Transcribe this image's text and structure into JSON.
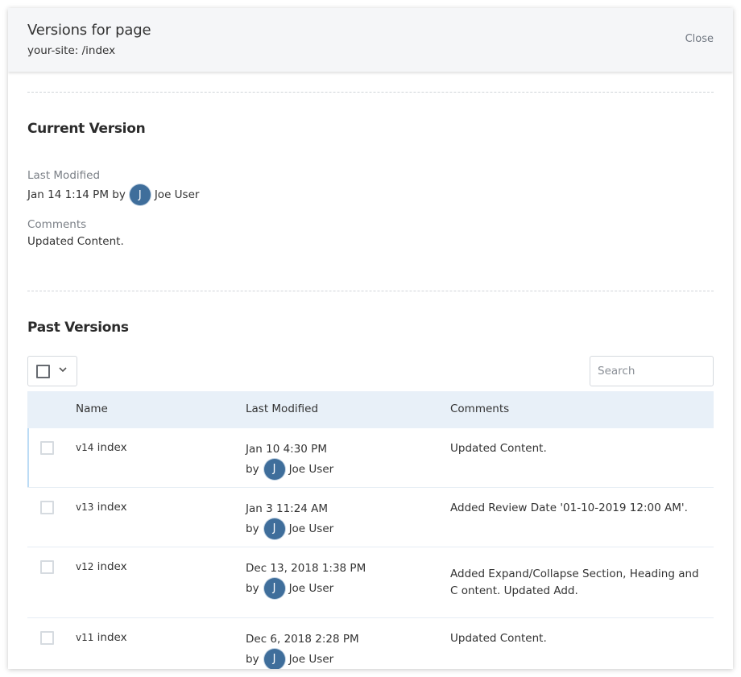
{
  "header": {
    "title": "Versions for page",
    "subtitle": "your-site: /index",
    "close_label": "Close"
  },
  "current_version": {
    "section_title": "Current Version",
    "last_modified_label": "Last Modified",
    "last_modified_value": "Jan 14 1:14 PM by",
    "user_initial": "J",
    "user_name": "Joe User",
    "comments_label": "Comments",
    "comments_value": "Updated Content."
  },
  "past_versions": {
    "section_title": "Past Versions",
    "bulk_select_icon": "checkbox-icon",
    "bulk_chevron_icon": "chevron-down-icon",
    "search_placeholder": "Search",
    "search_value": "",
    "columns": [
      "Name",
      "Last Modified",
      "Comments"
    ],
    "rows": [
      {
        "version": "v14",
        "name": "index",
        "date": "Jan 10 4:30 PM",
        "by_label": "by",
        "user_initial": "J",
        "user_name": "Joe User",
        "comment": "Updated Content.",
        "selected_marker": true
      },
      {
        "version": "v13",
        "name": "index",
        "date": "Jan 3 11:24 AM",
        "by_label": "by",
        "user_initial": "J",
        "user_name": "Joe User",
        "comment": "Added Review Date '01-10-2019 12:00 AM'.",
        "selected_marker": false
      },
      {
        "version": "v12",
        "name": "index",
        "date": "Dec 13, 2018 1:38 PM",
        "by_label": "by",
        "user_initial": "J",
        "user_name": "Joe User",
        "comment": "Added Expand/Collapse Section, Heading and C ontent. Updated Add.",
        "selected_marker": false
      },
      {
        "version": "v11",
        "name": "index",
        "date": "Dec 6, 2018 2:28 PM",
        "by_label": "by",
        "user_initial": "J",
        "user_name": "Joe User",
        "comment": "Updated Content.",
        "selected_marker": false
      }
    ]
  },
  "colors": {
    "avatar_bg": "#3f6e9b",
    "table_header_bg": "#e8f0f8",
    "header_bg": "#f5f6f8",
    "selected_row_marker": "#bcdcf5"
  }
}
